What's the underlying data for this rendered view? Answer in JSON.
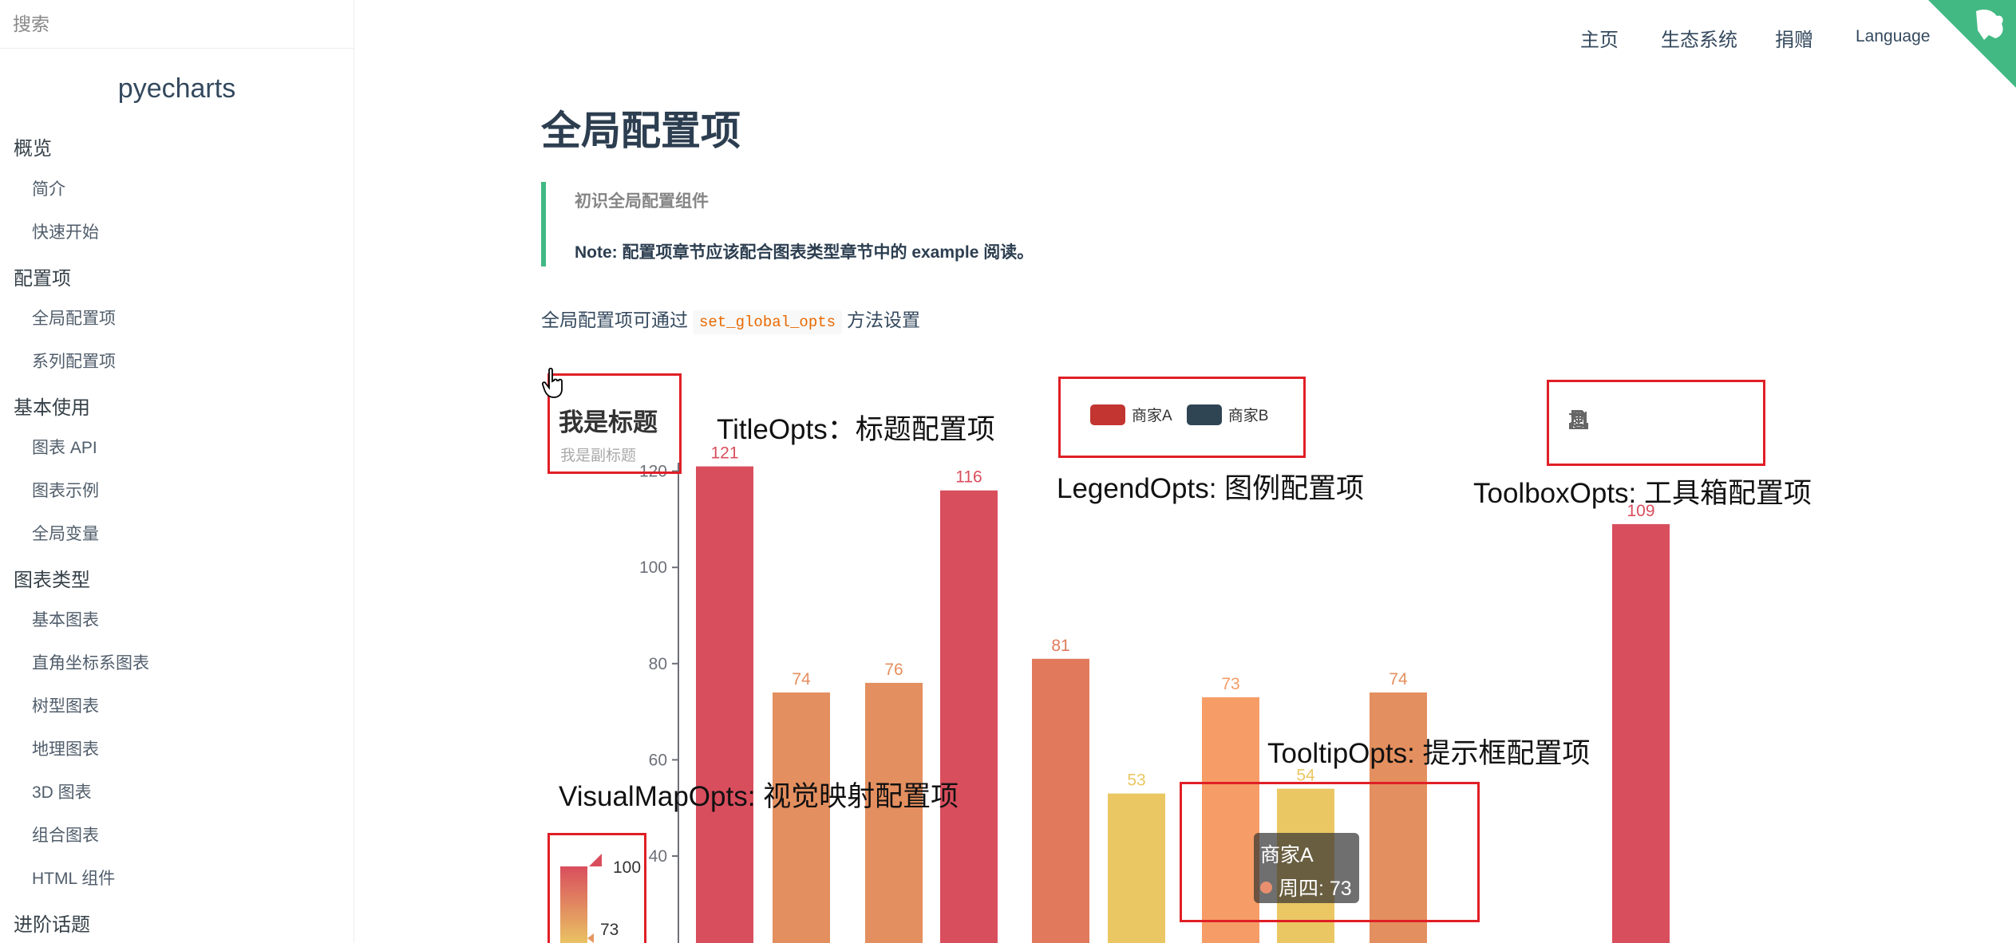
{
  "sidebar": {
    "search_placeholder": "搜索",
    "app_name": "pyecharts",
    "items": [
      {
        "label": "概览",
        "level": "section"
      },
      {
        "label": "简介",
        "level": "sub"
      },
      {
        "label": "快速开始",
        "level": "sub"
      },
      {
        "label": "配置项",
        "level": "section"
      },
      {
        "label": "全局配置项",
        "level": "sub"
      },
      {
        "label": "系列配置项",
        "level": "sub"
      },
      {
        "label": "基本使用",
        "level": "section"
      },
      {
        "label": "图表 API",
        "level": "sub"
      },
      {
        "label": "图表示例",
        "level": "sub"
      },
      {
        "label": "全局变量",
        "level": "sub"
      },
      {
        "label": "图表类型",
        "level": "section"
      },
      {
        "label": "基本图表",
        "level": "sub"
      },
      {
        "label": "直角坐标系图表",
        "level": "sub"
      },
      {
        "label": "树型图表",
        "level": "sub"
      },
      {
        "label": "地理图表",
        "level": "sub"
      },
      {
        "label": "3D 图表",
        "level": "sub"
      },
      {
        "label": "组合图表",
        "level": "sub"
      },
      {
        "label": "HTML 组件",
        "level": "sub"
      },
      {
        "label": "进阶话题",
        "level": "section"
      }
    ]
  },
  "topnav": {
    "home": "主页",
    "ecosystem": "生态系统",
    "donate": "捐赠",
    "language": "Language"
  },
  "content": {
    "title": "全局配置项",
    "tip_title": "初识全局配置组件",
    "tip_note": "Note: 配置项章节应该配合图表类型章节中的 example 阅读。",
    "para_before": "全局配置项可通过",
    "para_code": "set_global_opts",
    "para_after": "方法设置"
  },
  "chart_annotations": {
    "title_opts": "TitleOpts：标题配置项",
    "legend_opts": "LegendOpts: 图例配置项",
    "toolbox_opts": "ToolboxOpts: 工具箱配置项",
    "tooltip_opts": "TooltipOpts: 提示框配置项",
    "visualmap_opts": "VisualMapOpts: 视觉映射配置项"
  },
  "chart_data": {
    "type": "bar",
    "title": "我是标题",
    "subtitle": "我是副标题",
    "legend": [
      "商家A",
      "商家B"
    ],
    "legend_colors": [
      "#c23531",
      "#2f4554"
    ],
    "y_ticks": [
      120,
      100,
      80,
      60,
      40
    ],
    "ylim": [
      0,
      130
    ],
    "series": [
      {
        "name": "商家A",
        "values": [
          121,
          76,
          81,
          73,
          74
        ]
      },
      {
        "name": "商家B",
        "values": [
          74,
          116,
          53,
          54,
          109
        ]
      }
    ],
    "bar_order": [
      121,
      74,
      76,
      116,
      81,
      53,
      73,
      54,
      74,
      109
    ],
    "tooltip": {
      "series": "商家A",
      "label": "周四: 73",
      "color": "#e98f6f"
    },
    "visualmap": {
      "max_label": "100",
      "value_label": "73"
    },
    "toolbox_icons": [
      "download-icon",
      "refresh-icon",
      "data-view-icon",
      "crop-icon",
      "restore-icon"
    ]
  }
}
